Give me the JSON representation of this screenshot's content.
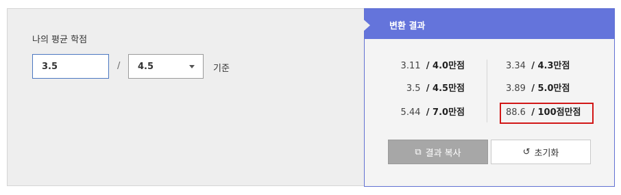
{
  "left": {
    "label": "나의 평균 학점",
    "gpa_value": "3.5",
    "separator": "/",
    "scale_selected": "4.5",
    "basis_text": "기준"
  },
  "result": {
    "header": "변환 결과",
    "rows": [
      {
        "num": "3.11",
        "unit": "/ 4.0만점"
      },
      {
        "num": "3.34",
        "unit": "/ 4.3만점"
      },
      {
        "num": "3.5",
        "unit": "/ 4.5만점"
      },
      {
        "num": "3.89",
        "unit": "/ 5.0만점"
      },
      {
        "num": "5.44",
        "unit": "/ 7.0만점"
      },
      {
        "num": "88.6",
        "unit": "/ 100점만점"
      }
    ],
    "copy_label": "결과 복사",
    "reset_label": "초기화",
    "highlight_color": "#d11515",
    "header_color": "#6474db"
  },
  "icons": [
    "copy-icon",
    "refresh-icon",
    "chevron-down-icon"
  ]
}
